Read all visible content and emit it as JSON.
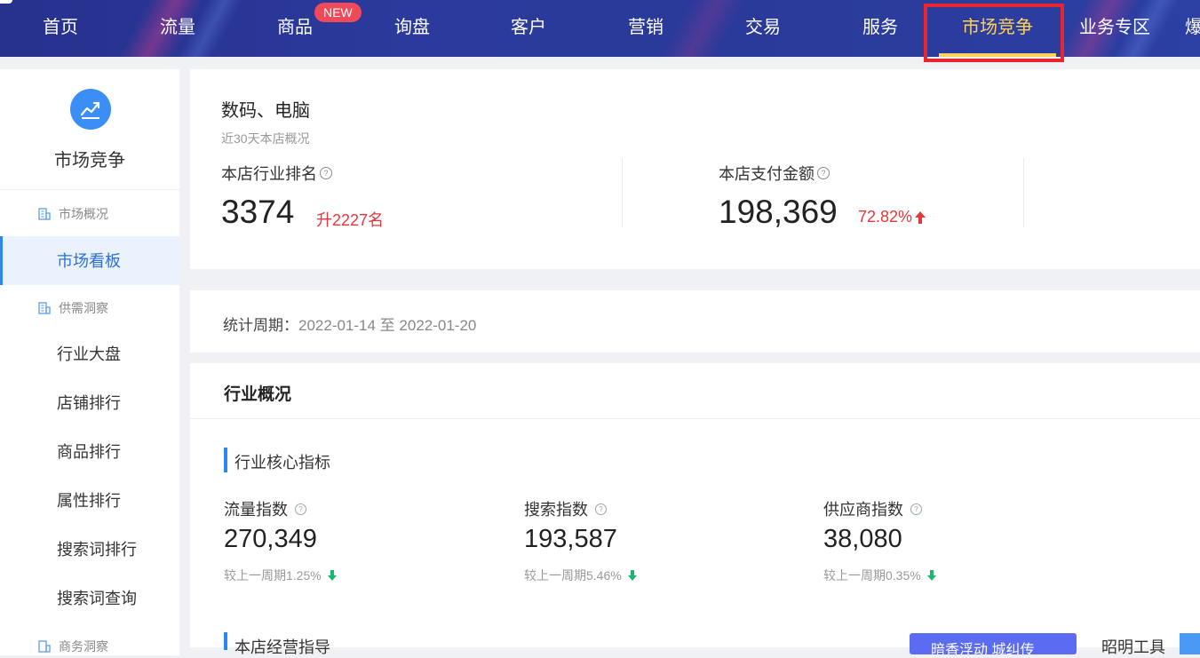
{
  "nav": {
    "items": [
      "首页",
      "流量",
      "商品",
      "询盘",
      "客户",
      "营销",
      "交易",
      "服务",
      "市场竞争",
      "业务专区",
      "爆"
    ],
    "active": "市场竞争",
    "new_badge": "NEW"
  },
  "sidebar": {
    "title": "市场竞争",
    "groups": [
      {
        "label": "市场概况",
        "items": [
          "市场看板"
        ]
      },
      {
        "label": "供需洞察",
        "items": [
          "行业大盘",
          "店铺排行",
          "商品排行",
          "属性排行",
          "搜索词排行",
          "搜索词查询"
        ]
      },
      {
        "label": "商务洞察",
        "items": []
      }
    ],
    "active_item": "市场看板"
  },
  "overview": {
    "category": "数码、电脑",
    "subtitle": "近30天本店概况",
    "rank": {
      "label": "本店行业排名",
      "value": "3374",
      "change": "升2227名"
    },
    "pay": {
      "label": "本店支付金额",
      "value": "198,369",
      "change": "72.82%"
    }
  },
  "period": {
    "label": "统计周期：",
    "value": "2022-01-14 至 2022-01-20"
  },
  "industry": {
    "title": "行业概况",
    "core_title": "行业核心指标",
    "metrics": [
      {
        "label": "流量指数",
        "value": "270,349",
        "compare": "较上一周期1.25%"
      },
      {
        "label": "搜索指数",
        "value": "193,587",
        "compare": "较上一周期5.46%"
      },
      {
        "label": "供应商指数",
        "value": "38,080",
        "compare": "较上一周期0.35%"
      }
    ],
    "next_section": "本店经营指导",
    "button_label": "暗香浮动 城纠传",
    "right_text": "昭明工具"
  },
  "colors": {
    "nav_bg": "#2a3a9a",
    "accent": "#2e86f5",
    "active_nav": "#ffd35a",
    "highlight_box": "#e8262d",
    "up_red": "#e8373a",
    "down_green": "#18b96e"
  }
}
